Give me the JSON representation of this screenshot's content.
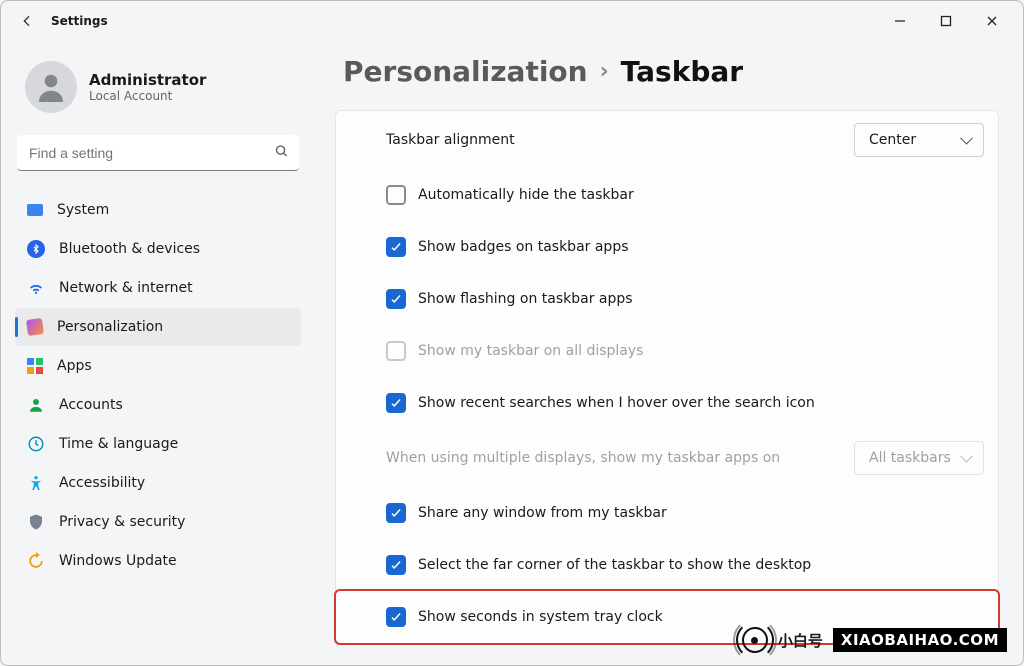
{
  "window": {
    "title": "Settings"
  },
  "user": {
    "name": "Administrator",
    "account_type": "Local Account"
  },
  "search": {
    "placeholder": "Find a setting"
  },
  "nav": {
    "items": [
      {
        "label": "System"
      },
      {
        "label": "Bluetooth & devices"
      },
      {
        "label": "Network & internet"
      },
      {
        "label": "Personalization"
      },
      {
        "label": "Apps"
      },
      {
        "label": "Accounts"
      },
      {
        "label": "Time & language"
      },
      {
        "label": "Accessibility"
      },
      {
        "label": "Privacy & security"
      },
      {
        "label": "Windows Update"
      }
    ],
    "active_index": 3
  },
  "breadcrumb": {
    "parent": "Personalization",
    "current": "Taskbar"
  },
  "settings": {
    "alignment": {
      "label": "Taskbar alignment",
      "value": "Center"
    },
    "auto_hide": {
      "label": "Automatically hide the taskbar",
      "checked": false
    },
    "badges": {
      "label": "Show badges on taskbar apps",
      "checked": true
    },
    "flashing": {
      "label": "Show flashing on taskbar apps",
      "checked": true
    },
    "all_displays": {
      "label": "Show my taskbar on all displays",
      "checked": false,
      "disabled": true
    },
    "recent_searches": {
      "label": "Show recent searches when I hover over the search icon",
      "checked": true
    },
    "multi_display_apps": {
      "label": "When using multiple displays, show my taskbar apps on",
      "value": "All taskbars",
      "disabled": true
    },
    "share_window": {
      "label": "Share any window from my taskbar",
      "checked": true
    },
    "far_corner": {
      "label": "Select the far corner of the taskbar to show the desktop",
      "checked": true
    },
    "show_seconds": {
      "label": "Show seconds in system tray clock",
      "checked": true
    }
  },
  "watermark": {
    "text_cn": "小白号",
    "text_en": "XIAOBAIHAO.COM"
  }
}
